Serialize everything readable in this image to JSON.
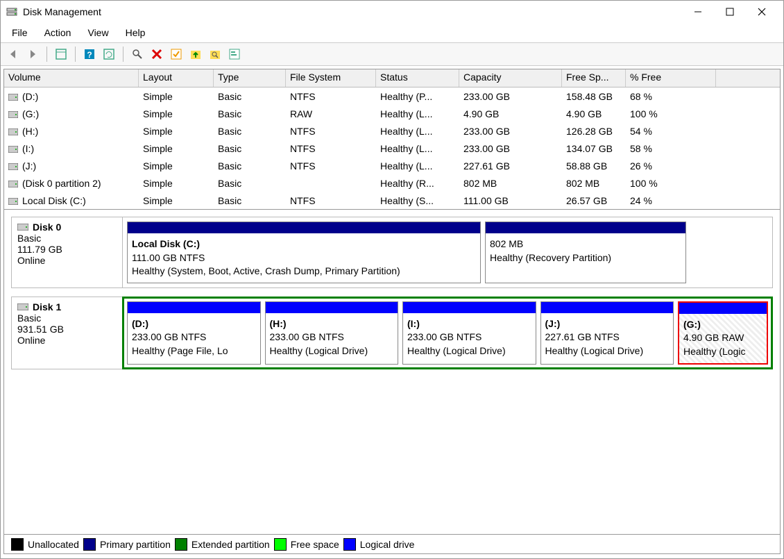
{
  "title": "Disk Management",
  "menu": {
    "file": "File",
    "action": "Action",
    "view": "View",
    "help": "Help"
  },
  "columns": {
    "volume": "Volume",
    "layout": "Layout",
    "type": "Type",
    "fs": "File System",
    "status": "Status",
    "capacity": "Capacity",
    "free": "Free Sp...",
    "pct": "% Free"
  },
  "volumes": [
    {
      "name": "(D:)",
      "layout": "Simple",
      "type": "Basic",
      "fs": "NTFS",
      "status": "Healthy (P...",
      "cap": "233.00 GB",
      "free": "158.48 GB",
      "pct": "68 %"
    },
    {
      "name": "(G:)",
      "layout": "Simple",
      "type": "Basic",
      "fs": "RAW",
      "status": "Healthy (L...",
      "cap": "4.90 GB",
      "free": "4.90 GB",
      "pct": "100 %"
    },
    {
      "name": "(H:)",
      "layout": "Simple",
      "type": "Basic",
      "fs": "NTFS",
      "status": "Healthy (L...",
      "cap": "233.00 GB",
      "free": "126.28 GB",
      "pct": "54 %"
    },
    {
      "name": "(I:)",
      "layout": "Simple",
      "type": "Basic",
      "fs": "NTFS",
      "status": "Healthy (L...",
      "cap": "233.00 GB",
      "free": "134.07 GB",
      "pct": "58 %"
    },
    {
      "name": "(J:)",
      "layout": "Simple",
      "type": "Basic",
      "fs": "NTFS",
      "status": "Healthy (L...",
      "cap": "227.61 GB",
      "free": "58.88 GB",
      "pct": "26 %"
    },
    {
      "name": "(Disk 0 partition 2)",
      "layout": "Simple",
      "type": "Basic",
      "fs": "",
      "status": "Healthy (R...",
      "cap": "802 MB",
      "free": "802 MB",
      "pct": "100 %"
    },
    {
      "name": "Local Disk (C:)",
      "layout": "Simple",
      "type": "Basic",
      "fs": "NTFS",
      "status": "Healthy (S...",
      "cap": "111.00 GB",
      "free": "26.57 GB",
      "pct": "24 %"
    }
  ],
  "disk0": {
    "name": "Disk 0",
    "type": "Basic",
    "size": "111.79 GB",
    "state": "Online",
    "p1": {
      "name": "Local Disk  (C:)",
      "line2": "111.00 GB NTFS",
      "line3": "Healthy (System, Boot, Active, Crash Dump, Primary Partition)"
    },
    "p2": {
      "name": "",
      "line2": "802 MB",
      "line3": "Healthy (Recovery Partition)"
    }
  },
  "disk1": {
    "name": "Disk 1",
    "type": "Basic",
    "size": "931.51 GB",
    "state": "Online",
    "p1": {
      "name": "(D:)",
      "line2": "233.00 GB NTFS",
      "line3": "Healthy (Page File, Lo"
    },
    "p2": {
      "name": "(H:)",
      "line2": "233.00 GB NTFS",
      "line3": "Healthy (Logical Drive)"
    },
    "p3": {
      "name": "(I:)",
      "line2": "233.00 GB NTFS",
      "line3": "Healthy (Logical Drive)"
    },
    "p4": {
      "name": "(J:)",
      "line2": "227.61 GB NTFS",
      "line3": "Healthy (Logical Drive)"
    },
    "p5": {
      "name": "(G:)",
      "line2": "4.90 GB RAW",
      "line3": "Healthy (Logic"
    }
  },
  "legend": {
    "unalloc": "Unallocated",
    "primary": "Primary partition",
    "extended": "Extended partition",
    "free": "Free space",
    "logical": "Logical drive"
  }
}
